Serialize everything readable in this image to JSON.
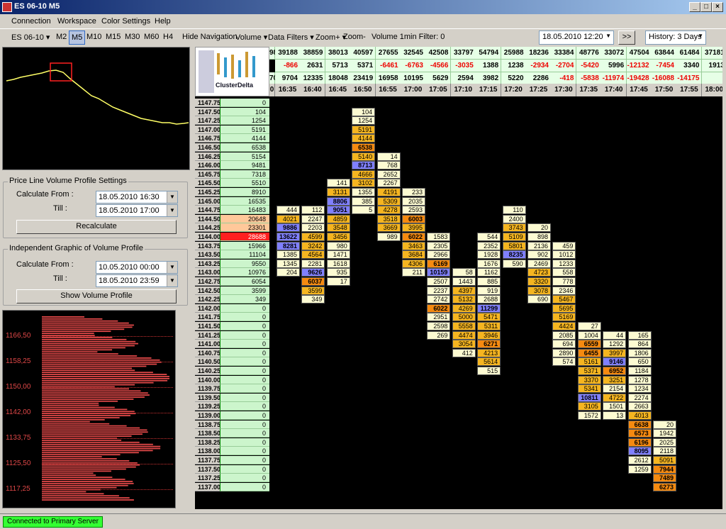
{
  "window": {
    "title": "ES 06-10 M5"
  },
  "menu": [
    "Connection",
    "Workspace",
    "Color Settings",
    "Help"
  ],
  "toolbar": {
    "symbol": "ES 06-10",
    "timeframes": [
      "M2",
      "M5",
      "M10",
      "M15",
      "M30",
      "M60",
      "H4"
    ],
    "selected_timeframe": "M5",
    "hide_navigation": "Hide Navigation",
    "volume": "Volume",
    "data_filters": "Data Filters",
    "zoom_in": "Zoom+",
    "zoom_out": "Zoom-",
    "filter_label": "Volume 1min Filter: 0",
    "datetime": "18.05.2010 12:20",
    "go": ">>",
    "history": "History: 3 Days"
  },
  "price_line_panel": {
    "title": "Price Line Volume Profile Settings",
    "calc_from_label": "Calculate From :",
    "calc_from": "18.05.2010 16:30",
    "till_label": "Till :",
    "till": "18.05.2010 17:00",
    "button": "Recalculate"
  },
  "independent_panel": {
    "title": "Independent Graphic of Volume Profile",
    "calc_from_label": "Calculate From :",
    "calc_from": "10.05.2010 00:00",
    "till_label": "Till :",
    "till": "18.05.2010 23:59",
    "button": "Show Volume Profile"
  },
  "profile_axis": [
    "1166,50",
    "1158,25",
    "1150,00",
    "1142,00",
    "1133,75",
    "1125,50",
    "1117,25"
  ],
  "thumb_label": "ClusterDelta",
  "columns": [
    {
      "time": "16:35",
      "vol": "39188",
      "delta": "-866",
      "cum": "9704"
    },
    {
      "time": "16:40",
      "vol": "38859",
      "delta": "2631",
      "cum": "12335"
    },
    {
      "time": "16:45",
      "vol": "38013",
      "delta": "5713",
      "cum": "18048"
    },
    {
      "time": "16:50",
      "vol": "40597",
      "delta": "5371",
      "cum": "23419"
    },
    {
      "time": "16:55",
      "vol": "27655",
      "delta": "-6461",
      "cum": "16958"
    },
    {
      "time": "17:00",
      "vol": "32545",
      "delta": "-6763",
      "cum": "10195"
    },
    {
      "time": "17:05",
      "vol": "42508",
      "delta": "-4566",
      "cum": "5629"
    },
    {
      "time": "17:10",
      "vol": "33797",
      "delta": "-3035",
      "cum": "2594"
    },
    {
      "time": "17:15",
      "vol": "54794",
      "delta": "1388",
      "cum": "3982"
    },
    {
      "time": "17:20",
      "vol": "25988",
      "delta": "1238",
      "cum": "5220"
    },
    {
      "time": "17:25",
      "vol": "18236",
      "delta": "-2934",
      "cum": "2286"
    },
    {
      "time": "17:30",
      "vol": "33384",
      "delta": "-2704",
      "cum": "-418"
    },
    {
      "time": "17:35",
      "vol": "48776",
      "delta": "-5420",
      "cum": "-5838"
    },
    {
      "time": "17:40",
      "vol": "33072",
      "delta": "5996",
      "cum": "-11974"
    },
    {
      "time": "17:45",
      "vol": "47504",
      "delta": "-12132",
      "cum": "-19428"
    },
    {
      "time": "17:50",
      "vol": "63844",
      "delta": "-7454",
      "cum": "-16088"
    },
    {
      "time": "17:55",
      "vol": "61484",
      "delta": "3340",
      "cum": "-14175"
    },
    {
      "time": "18:00",
      "vol": "37181",
      "delta": "1913",
      "cum": ""
    }
  ],
  "first_col": {
    "vol": "98",
    "delta": "",
    "cum": "70",
    "time": "0"
  },
  "prices": [
    "1147.75",
    "1147.50",
    "1147.25",
    "1147.00",
    "1146.75",
    "1146.50",
    "1146.25",
    "1146.00",
    "1145.75",
    "1145.50",
    "1145.25",
    "1145.00",
    "1144.75",
    "1144.50",
    "1144.25",
    "1144.00",
    "1143.75",
    "1143.50",
    "1143.25",
    "1143.00",
    "1142.75",
    "1142.50",
    "1142.25",
    "1142.00",
    "1141.75",
    "1141.50",
    "1141.25",
    "1141.00",
    "1140.75",
    "1140.50",
    "1140.25",
    "1140.00",
    "1139.75",
    "1139.50",
    "1139.25",
    "1139.00",
    "1138.75",
    "1138.50",
    "1138.25",
    "1138.00",
    "1137.75",
    "1137.50",
    "1137.25",
    "1137.00"
  ],
  "volumes": [
    "0",
    "104",
    "1254",
    "5191",
    "4144",
    "6538",
    "5154",
    "9481",
    "7318",
    "5510",
    "8910",
    "16535",
    "16483",
    "20648",
    "23301",
    "28688",
    "15966",
    "11104",
    "9550",
    "10976",
    "6054",
    "3599",
    "349",
    "0",
    "0",
    "0",
    "0",
    "0",
    "0",
    "0",
    "0",
    "0",
    "0",
    "0",
    "0",
    "0",
    "0",
    "0",
    "0",
    "0",
    "0",
    "0",
    "0",
    "0"
  ],
  "cells": [
    {
      "c": 3,
      "r": 1,
      "v": "104"
    },
    {
      "c": 3,
      "r": 2,
      "v": "1254"
    },
    {
      "c": 3,
      "r": 3,
      "v": "5191"
    },
    {
      "c": 3,
      "r": 4,
      "v": "4144"
    },
    {
      "c": 3,
      "r": 5,
      "v": "6538"
    },
    {
      "c": 3,
      "r": 6,
      "v": "5140"
    },
    {
      "c": 3,
      "r": 7,
      "v": "8713"
    },
    {
      "c": 3,
      "r": 8,
      "v": "4666"
    },
    {
      "c": 3,
      "r": 9,
      "v": "3102"
    },
    {
      "c": 3,
      "r": 10,
      "v": "1355"
    },
    {
      "c": 3,
      "r": 11,
      "v": "385"
    },
    {
      "c": 3,
      "r": 12,
      "v": "5"
    },
    {
      "c": 4,
      "r": 6,
      "v": "14"
    },
    {
      "c": 4,
      "r": 7,
      "v": "768"
    },
    {
      "c": 4,
      "r": 8,
      "v": "2652"
    },
    {
      "c": 4,
      "r": 9,
      "v": "2267"
    },
    {
      "c": 4,
      "r": 10,
      "v": "4191"
    },
    {
      "c": 4,
      "r": 11,
      "v": "5309"
    },
    {
      "c": 4,
      "r": 12,
      "v": "4278"
    },
    {
      "c": 4,
      "r": 13,
      "v": "3518"
    },
    {
      "c": 4,
      "r": 14,
      "v": "3669"
    },
    {
      "c": 4,
      "r": 15,
      "v": "989"
    },
    {
      "c": 2,
      "r": 9,
      "v": "141"
    },
    {
      "c": 2,
      "r": 10,
      "v": "3131"
    },
    {
      "c": 2,
      "r": 11,
      "v": "8806"
    },
    {
      "c": 2,
      "r": 12,
      "v": "9051"
    },
    {
      "c": 2,
      "r": 13,
      "v": "4859"
    },
    {
      "c": 2,
      "r": 14,
      "v": "3548"
    },
    {
      "c": 2,
      "r": 15,
      "v": "3456"
    },
    {
      "c": 2,
      "r": 16,
      "v": "980"
    },
    {
      "c": 2,
      "r": 17,
      "v": "1471"
    },
    {
      "c": 2,
      "r": 18,
      "v": "1618"
    },
    {
      "c": 2,
      "r": 19,
      "v": "935"
    },
    {
      "c": 2,
      "r": 20,
      "v": "17"
    },
    {
      "c": 1,
      "r": 12,
      "v": "112"
    },
    {
      "c": 1,
      "r": 13,
      "v": "2247"
    },
    {
      "c": 1,
      "r": 14,
      "v": "2203"
    },
    {
      "c": 1,
      "r": 15,
      "v": "4599"
    },
    {
      "c": 1,
      "r": 16,
      "v": "3242"
    },
    {
      "c": 1,
      "r": 17,
      "v": "4564"
    },
    {
      "c": 1,
      "r": 18,
      "v": "2281"
    },
    {
      "c": 1,
      "r": 19,
      "v": "9626"
    },
    {
      "c": 1,
      "r": 20,
      "v": "6037"
    },
    {
      "c": 1,
      "r": 21,
      "v": "3599"
    },
    {
      "c": 1,
      "r": 22,
      "v": "349"
    },
    {
      "c": 0,
      "r": 12,
      "v": "444"
    },
    {
      "c": 0,
      "r": 13,
      "v": "4021"
    },
    {
      "c": 0,
      "r": 14,
      "v": "9886"
    },
    {
      "c": 0,
      "r": 15,
      "v": "13622"
    },
    {
      "c": 0,
      "r": 16,
      "v": "8281"
    },
    {
      "c": 0,
      "r": 17,
      "v": "1385"
    },
    {
      "c": 0,
      "r": 18,
      "v": "1345"
    },
    {
      "c": 0,
      "r": 19,
      "v": "204"
    },
    {
      "c": 5,
      "r": 10,
      "v": "233"
    },
    {
      "c": 5,
      "r": 11,
      "v": "2035"
    },
    {
      "c": 5,
      "r": 12,
      "v": "2593"
    },
    {
      "c": 5,
      "r": 13,
      "v": "6003"
    },
    {
      "c": 5,
      "r": 14,
      "v": "3995"
    },
    {
      "c": 5,
      "r": 15,
      "v": "6022"
    },
    {
      "c": 5,
      "r": 16,
      "v": "3463"
    },
    {
      "c": 5,
      "r": 17,
      "v": "3684"
    },
    {
      "c": 5,
      "r": 18,
      "v": "4306"
    },
    {
      "c": 5,
      "r": 19,
      "v": "211"
    },
    {
      "c": 6,
      "r": 15,
      "v": "1583"
    },
    {
      "c": 6,
      "r": 16,
      "v": "2305"
    },
    {
      "c": 6,
      "r": 17,
      "v": "2966"
    },
    {
      "c": 6,
      "r": 18,
      "v": "6169"
    },
    {
      "c": 6,
      "r": 19,
      "v": "10159"
    },
    {
      "c": 6,
      "r": 20,
      "v": "2507"
    },
    {
      "c": 6,
      "r": 21,
      "v": "2237"
    },
    {
      "c": 6,
      "r": 22,
      "v": "2742"
    },
    {
      "c": 6,
      "r": 23,
      "v": "6022"
    },
    {
      "c": 6,
      "r": 24,
      "v": "2951"
    },
    {
      "c": 6,
      "r": 25,
      "v": "2598"
    },
    {
      "c": 6,
      "r": 26,
      "v": "269"
    },
    {
      "c": 7,
      "r": 19,
      "v": "58"
    },
    {
      "c": 7,
      "r": 20,
      "v": "1443"
    },
    {
      "c": 7,
      "r": 21,
      "v": "4397"
    },
    {
      "c": 7,
      "r": 22,
      "v": "5132"
    },
    {
      "c": 7,
      "r": 23,
      "v": "4269"
    },
    {
      "c": 7,
      "r": 24,
      "v": "5000"
    },
    {
      "c": 7,
      "r": 25,
      "v": "5558"
    },
    {
      "c": 7,
      "r": 26,
      "v": "4474"
    },
    {
      "c": 7,
      "r": 27,
      "v": "3054"
    },
    {
      "c": 7,
      "r": 28,
      "v": "412"
    },
    {
      "c": 8,
      "r": 15,
      "v": "544"
    },
    {
      "c": 8,
      "r": 16,
      "v": "2352"
    },
    {
      "c": 8,
      "r": 17,
      "v": "1928"
    },
    {
      "c": 8,
      "r": 18,
      "v": "1676"
    },
    {
      "c": 8,
      "r": 19,
      "v": "1162"
    },
    {
      "c": 8,
      "r": 20,
      "v": "885"
    },
    {
      "c": 8,
      "r": 21,
      "v": "919"
    },
    {
      "c": 8,
      "r": 22,
      "v": "2688"
    },
    {
      "c": 8,
      "r": 23,
      "v": "11299"
    },
    {
      "c": 8,
      "r": 24,
      "v": "5471"
    },
    {
      "c": 8,
      "r": 25,
      "v": "5311"
    },
    {
      "c": 8,
      "r": 26,
      "v": "3946"
    },
    {
      "c": 8,
      "r": 27,
      "v": "6271"
    },
    {
      "c": 8,
      "r": 28,
      "v": "4213"
    },
    {
      "c": 8,
      "r": 29,
      "v": "5614"
    },
    {
      "c": 8,
      "r": 30,
      "v": "515"
    },
    {
      "c": 9,
      "r": 12,
      "v": "110"
    },
    {
      "c": 9,
      "r": 13,
      "v": "2400"
    },
    {
      "c": 9,
      "r": 14,
      "v": "3743"
    },
    {
      "c": 9,
      "r": 15,
      "v": "5109"
    },
    {
      "c": 9,
      "r": 16,
      "v": "5801"
    },
    {
      "c": 9,
      "r": 17,
      "v": "8235"
    },
    {
      "c": 9,
      "r": 18,
      "v": "590"
    },
    {
      "c": 10,
      "r": 14,
      "v": "20"
    },
    {
      "c": 10,
      "r": 15,
      "v": "898"
    },
    {
      "c": 10,
      "r": 16,
      "v": "2136"
    },
    {
      "c": 10,
      "r": 17,
      "v": "902"
    },
    {
      "c": 10,
      "r": 18,
      "v": "2469"
    },
    {
      "c": 10,
      "r": 19,
      "v": "4723"
    },
    {
      "c": 10,
      "r": 20,
      "v": "3320"
    },
    {
      "c": 10,
      "r": 21,
      "v": "3078"
    },
    {
      "c": 10,
      "r": 22,
      "v": "690"
    },
    {
      "c": 11,
      "r": 16,
      "v": "459"
    },
    {
      "c": 11,
      "r": 17,
      "v": "1012"
    },
    {
      "c": 11,
      "r": 18,
      "v": "1233"
    },
    {
      "c": 11,
      "r": 19,
      "v": "558"
    },
    {
      "c": 11,
      "r": 20,
      "v": "778"
    },
    {
      "c": 11,
      "r": 21,
      "v": "2346"
    },
    {
      "c": 11,
      "r": 22,
      "v": "5467"
    },
    {
      "c": 11,
      "r": 23,
      "v": "5695"
    },
    {
      "c": 11,
      "r": 24,
      "v": "5169"
    },
    {
      "c": 11,
      "r": 25,
      "v": "4424"
    },
    {
      "c": 11,
      "r": 26,
      "v": "2085"
    },
    {
      "c": 11,
      "r": 27,
      "v": "694"
    },
    {
      "c": 11,
      "r": 28,
      "v": "2890"
    },
    {
      "c": 11,
      "r": 29,
      "v": "574"
    },
    {
      "c": 12,
      "r": 25,
      "v": "27"
    },
    {
      "c": 12,
      "r": 26,
      "v": "1004"
    },
    {
      "c": 12,
      "r": 27,
      "v": "6559"
    },
    {
      "c": 12,
      "r": 28,
      "v": "6455"
    },
    {
      "c": 12,
      "r": 29,
      "v": "5161"
    },
    {
      "c": 12,
      "r": 30,
      "v": "5371"
    },
    {
      "c": 12,
      "r": 31,
      "v": "3370"
    },
    {
      "c": 12,
      "r": 32,
      "v": "5341"
    },
    {
      "c": 12,
      "r": 33,
      "v": "10811"
    },
    {
      "c": 12,
      "r": 34,
      "v": "3105"
    },
    {
      "c": 12,
      "r": 35,
      "v": "1572"
    },
    {
      "c": 13,
      "r": 26,
      "v": "44"
    },
    {
      "c": 13,
      "r": 27,
      "v": "1292"
    },
    {
      "c": 13,
      "r": 28,
      "v": "3997"
    },
    {
      "c": 13,
      "r": 29,
      "v": "9146"
    },
    {
      "c": 13,
      "r": 30,
      "v": "6952"
    },
    {
      "c": 13,
      "r": 31,
      "v": "3251"
    },
    {
      "c": 13,
      "r": 32,
      "v": "2154"
    },
    {
      "c": 13,
      "r": 33,
      "v": "4722"
    },
    {
      "c": 13,
      "r": 34,
      "v": "1501"
    },
    {
      "c": 13,
      "r": 35,
      "v": "13"
    },
    {
      "c": 14,
      "r": 26,
      "v": "165"
    },
    {
      "c": 14,
      "r": 27,
      "v": "864"
    },
    {
      "c": 14,
      "r": 28,
      "v": "1806"
    },
    {
      "c": 14,
      "r": 29,
      "v": "650"
    },
    {
      "c": 14,
      "r": 30,
      "v": "1184"
    },
    {
      "c": 14,
      "r": 31,
      "v": "1278"
    },
    {
      "c": 14,
      "r": 32,
      "v": "1234"
    },
    {
      "c": 14,
      "r": 33,
      "v": "2274"
    },
    {
      "c": 14,
      "r": 34,
      "v": "2663"
    },
    {
      "c": 14,
      "r": 35,
      "v": "4013"
    },
    {
      "c": 14,
      "r": 36,
      "v": "6638"
    },
    {
      "c": 14,
      "r": 37,
      "v": "6573"
    },
    {
      "c": 14,
      "r": 38,
      "v": "6196"
    },
    {
      "c": 14,
      "r": 39,
      "v": "8095"
    },
    {
      "c": 14,
      "r": 40,
      "v": "2612"
    },
    {
      "c": 14,
      "r": 41,
      "v": "1259"
    },
    {
      "c": 15,
      "r": 36,
      "v": "20"
    },
    {
      "c": 15,
      "r": 37,
      "v": "1942"
    },
    {
      "c": 15,
      "r": 38,
      "v": "2025"
    },
    {
      "c": 15,
      "r": 39,
      "v": "2118"
    },
    {
      "c": 15,
      "r": 40,
      "v": "5091"
    },
    {
      "c": 15,
      "r": 41,
      "v": "7944"
    },
    {
      "c": 15,
      "r": 42,
      "v": "7489"
    },
    {
      "c": 15,
      "r": 43,
      "v": "6273"
    }
  ],
  "status": "Connected to Primary Server",
  "colors": {
    "pale": "#fdfbd2",
    "orange": "#f5b520",
    "darkorange": "#f58a10",
    "blue": "#8080ff",
    "red": "#ff2020",
    "peach": "#ffc89a",
    "green": "#ccf5cc"
  }
}
